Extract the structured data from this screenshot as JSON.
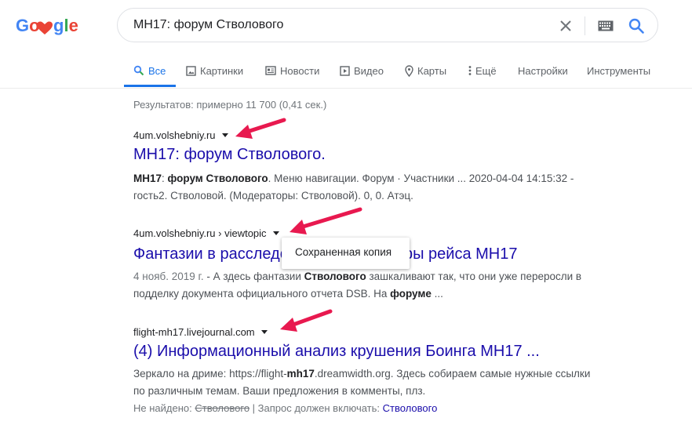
{
  "logo": {
    "text": "Google"
  },
  "search": {
    "query": "MH17: форум Стволового"
  },
  "tabs": [
    {
      "label": "Все",
      "icon": "search-icon"
    },
    {
      "label": "Картинки",
      "icon": "image-icon"
    },
    {
      "label": "Новости",
      "icon": "news-icon"
    },
    {
      "label": "Видео",
      "icon": "video-icon"
    },
    {
      "label": "Карты",
      "icon": "map-pin-icon"
    },
    {
      "label": "Ещё",
      "icon": "more-vert-icon"
    },
    {
      "label": "Настройки"
    },
    {
      "label": "Инструменты"
    }
  ],
  "stats": "Результатов: примерно 11 700 (0,41 сек.)",
  "results": [
    {
      "cite": "4um.volshebniy.ru",
      "title": "MH17: форум Стволового.",
      "snippet_parts": [
        "MH17",
        ": ",
        "форум Стволового",
        ". Меню навигации. Форум · Участники ... 2020-04-04 14:15:32 - гость2. Стволовой. (Модераторы: Стволовой). 0, 0. Атэц."
      ]
    },
    {
      "cite": "4um.volshebniy.ru › viewtopic",
      "title": "Фантазии в расследовании катастрофы рейса MH17",
      "date": "4 нояб. 2019 г.",
      "snippet_parts": [
        " - А здесь фантазии ",
        "Стволового",
        " зашкаливают так, что они уже переросли в подделку документа официального отчета DSB. На ",
        "форуме",
        " ..."
      ]
    },
    {
      "cite": "flight-mh17.livejournal.com",
      "title": "(4) Информационный анализ крушения Боинга MH17 ...",
      "snippet_parts": [
        "Зеркало на дриме: https://flight-",
        "mh17",
        ".dreamwidth.org. Здесь собираем самые нужные ссылки по различным темам. Ваши предложения в комменты, плз."
      ],
      "missing_label": "Не найдено: ",
      "missing_word": "Стволового",
      "must_include_label": " | Запрос должен включать: ",
      "must_include_word": "Стволового"
    }
  ],
  "popup": {
    "label": "Сохраненная копия"
  },
  "colors": {
    "link": "#1a0dab",
    "accent": "#1a73e8",
    "arrow": "#e8194f"
  }
}
